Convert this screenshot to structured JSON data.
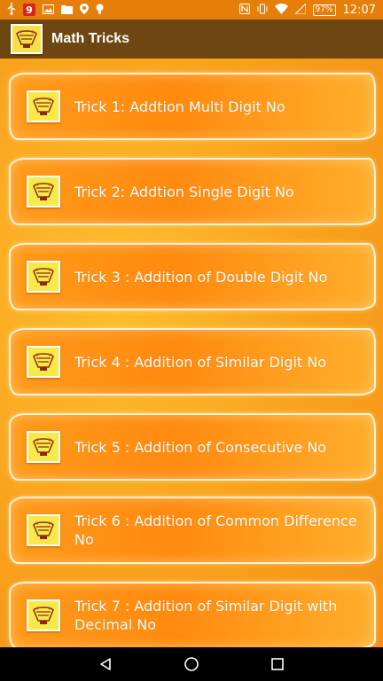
{
  "status_bar": {
    "badge": "9",
    "battery": "97%",
    "time": "12:07"
  },
  "app_bar": {
    "title": "Math Tricks"
  },
  "tricks": [
    {
      "label": "Trick 1: Addtion Multi Digit No"
    },
    {
      "label": "Trick 2: Addtion Single Digit No"
    },
    {
      "label": "Trick 3 : Addition of Double Digit No"
    },
    {
      "label": "Trick 4 : Addition of Similar Digit No"
    },
    {
      "label": "Trick 5 : Addition of Consecutive No"
    },
    {
      "label": "Trick 6 : Addition of Common Difference No"
    },
    {
      "label": "Trick 7 : Addition of Similar Digit with Decimal No"
    }
  ],
  "icons": {
    "app": "math-tricks-logo-icon",
    "back": "back-icon",
    "home": "home-icon",
    "recents": "recents-icon"
  },
  "colors": {
    "status_bar": "#e57f0a",
    "app_bar": "#6e4611",
    "background": "#f9a41d",
    "item_border": "#fff2d8"
  }
}
